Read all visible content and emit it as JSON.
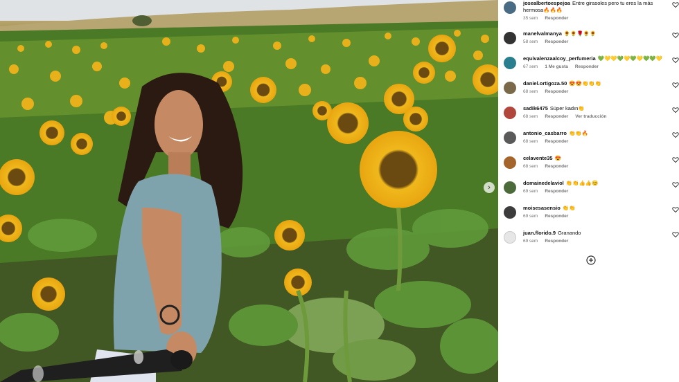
{
  "comments": [
    {
      "user": "josealbertoespejoa",
      "text": "Entre girasoles pero tu eres la más hermosa🔥🔥🔥",
      "time": "35 sem",
      "likes": "",
      "reply": "Responder",
      "translate": "",
      "avatar_color": "#4a6b84"
    },
    {
      "user": "manelvalmanya",
      "text": "🌻🌻🌹🌻🌻",
      "time": "58 sem",
      "likes": "",
      "reply": "Responder",
      "translate": "",
      "avatar_color": "#333333"
    },
    {
      "user": "equivalenzaalcoy_perfumeria",
      "text": "💚💛💛💚💛💚💛💚💚💛",
      "time": "67 sem",
      "likes": "1 Me gusta",
      "reply": "Responder",
      "translate": "",
      "avatar_color": "#2a7f8f"
    },
    {
      "user": "daniel.ortigoza.50",
      "text": "😍😍👏👏👏",
      "time": "68 sem",
      "likes": "",
      "reply": "Responder",
      "translate": "",
      "avatar_color": "#7a6a4a"
    },
    {
      "user": "sadik6475",
      "text": "Süper kadın👏",
      "time": "68 sem",
      "likes": "",
      "reply": "Responder",
      "translate": "Ver traducción",
      "avatar_color": "#b0463c"
    },
    {
      "user": "antonio_casbarro",
      "text": "👏👏🔥",
      "time": "68 sem",
      "likes": "",
      "reply": "Responder",
      "translate": "",
      "avatar_color": "#5a5a5a"
    },
    {
      "user": "celavente35",
      "text": "😍",
      "time": "68 sem",
      "likes": "",
      "reply": "Responder",
      "translate": "",
      "avatar_color": "#a3652c"
    },
    {
      "user": "domainedelaviol",
      "text": "👏👏👍👍😊",
      "time": "69 sem",
      "likes": "",
      "reply": "Responder",
      "translate": "",
      "avatar_color": "#4d6b3a"
    },
    {
      "user": "moisesasensio",
      "text": "👏👏",
      "time": "69 sem",
      "likes": "",
      "reply": "Responder",
      "translate": "",
      "avatar_color": "#3c3c3c"
    },
    {
      "user": "juan.florido.9",
      "text": "Granando",
      "time": "69 sem",
      "likes": "",
      "reply": "Responder",
      "translate": "",
      "avatar_color": "#e6e6e6"
    }
  ],
  "icons": {
    "like": "heart-icon",
    "add": "plus-circle-icon",
    "next": "chevron-right-icon"
  }
}
